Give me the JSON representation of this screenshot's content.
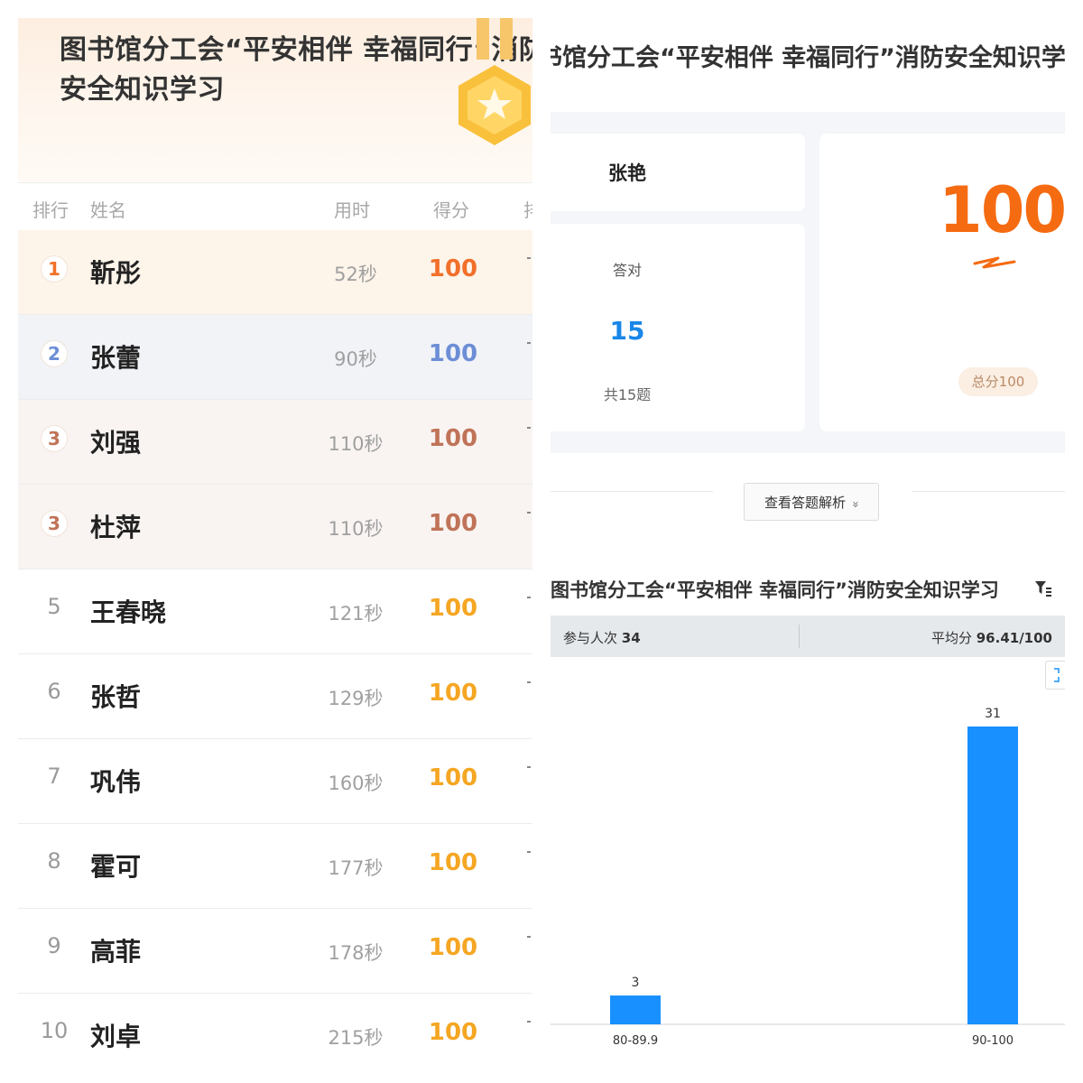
{
  "leaderboard": {
    "banner_title": "图书馆分工会“平安相伴 幸福同行”消防安全知识学习",
    "headers": {
      "rank": "排行",
      "name": "姓名",
      "time": "用时",
      "score": "得分",
      "extra": "排"
    },
    "rows": [
      {
        "rank": "1",
        "name": "靳彤",
        "time": "52秒",
        "score": "100"
      },
      {
        "rank": "2",
        "name": "张蕾",
        "time": "90秒",
        "score": "100"
      },
      {
        "rank": "3",
        "name": "刘强",
        "time": "110秒",
        "score": "100"
      },
      {
        "rank": "3",
        "name": "杜萍",
        "time": "110秒",
        "score": "100"
      },
      {
        "rank": "5",
        "name": "王春晓",
        "time": "121秒",
        "score": "100"
      },
      {
        "rank": "6",
        "name": "张哲",
        "time": "129秒",
        "score": "100"
      },
      {
        "rank": "7",
        "name": "巩伟",
        "time": "160秒",
        "score": "100"
      },
      {
        "rank": "8",
        "name": "霍可",
        "time": "177秒",
        "score": "100"
      },
      {
        "rank": "9",
        "name": "高菲",
        "time": "178秒",
        "score": "100"
      },
      {
        "rank": "10",
        "name": "刘卓",
        "time": "215秒",
        "score": "100"
      }
    ]
  },
  "result": {
    "title": "书馆分工会“平安相伴 幸福同行”消防安全知识学",
    "user_name": "张艳",
    "correct_label": "答对",
    "correct_count": "15",
    "total_questions": "共15题",
    "score": "100",
    "total_score_pill": "总分100",
    "analysis_button": "查看答题解析",
    "analysis_chevron": "»"
  },
  "stats": {
    "title": "图书馆分工会“平安相伴 幸福同行”消防安全知识学习",
    "participants_label": "参与人次",
    "participants_value": "34",
    "average_label": "平均分",
    "average_value": "96.41/100"
  },
  "colors": {
    "orange": "#f56b12",
    "blue_rank": "#6d8ed6",
    "bronze": "#c07358",
    "gold": "#f5a623",
    "bar_blue": "#1890ff",
    "correct_blue": "#1a87e8"
  },
  "icons": {
    "medal": "medal-star-icon",
    "filter": "filter-icon",
    "expand": "expand-icon",
    "chevron": "chevron-down-icon"
  },
  "chart_data": {
    "type": "bar",
    "categories": [
      "80-89.9",
      "90-100"
    ],
    "values": [
      3,
      31
    ],
    "data_labels": [
      "3",
      "31"
    ],
    "title": "",
    "xlabel": "",
    "ylabel": "",
    "ylim": [
      0,
      31
    ],
    "grid": false,
    "legend": "none",
    "color": "#1890ff"
  }
}
